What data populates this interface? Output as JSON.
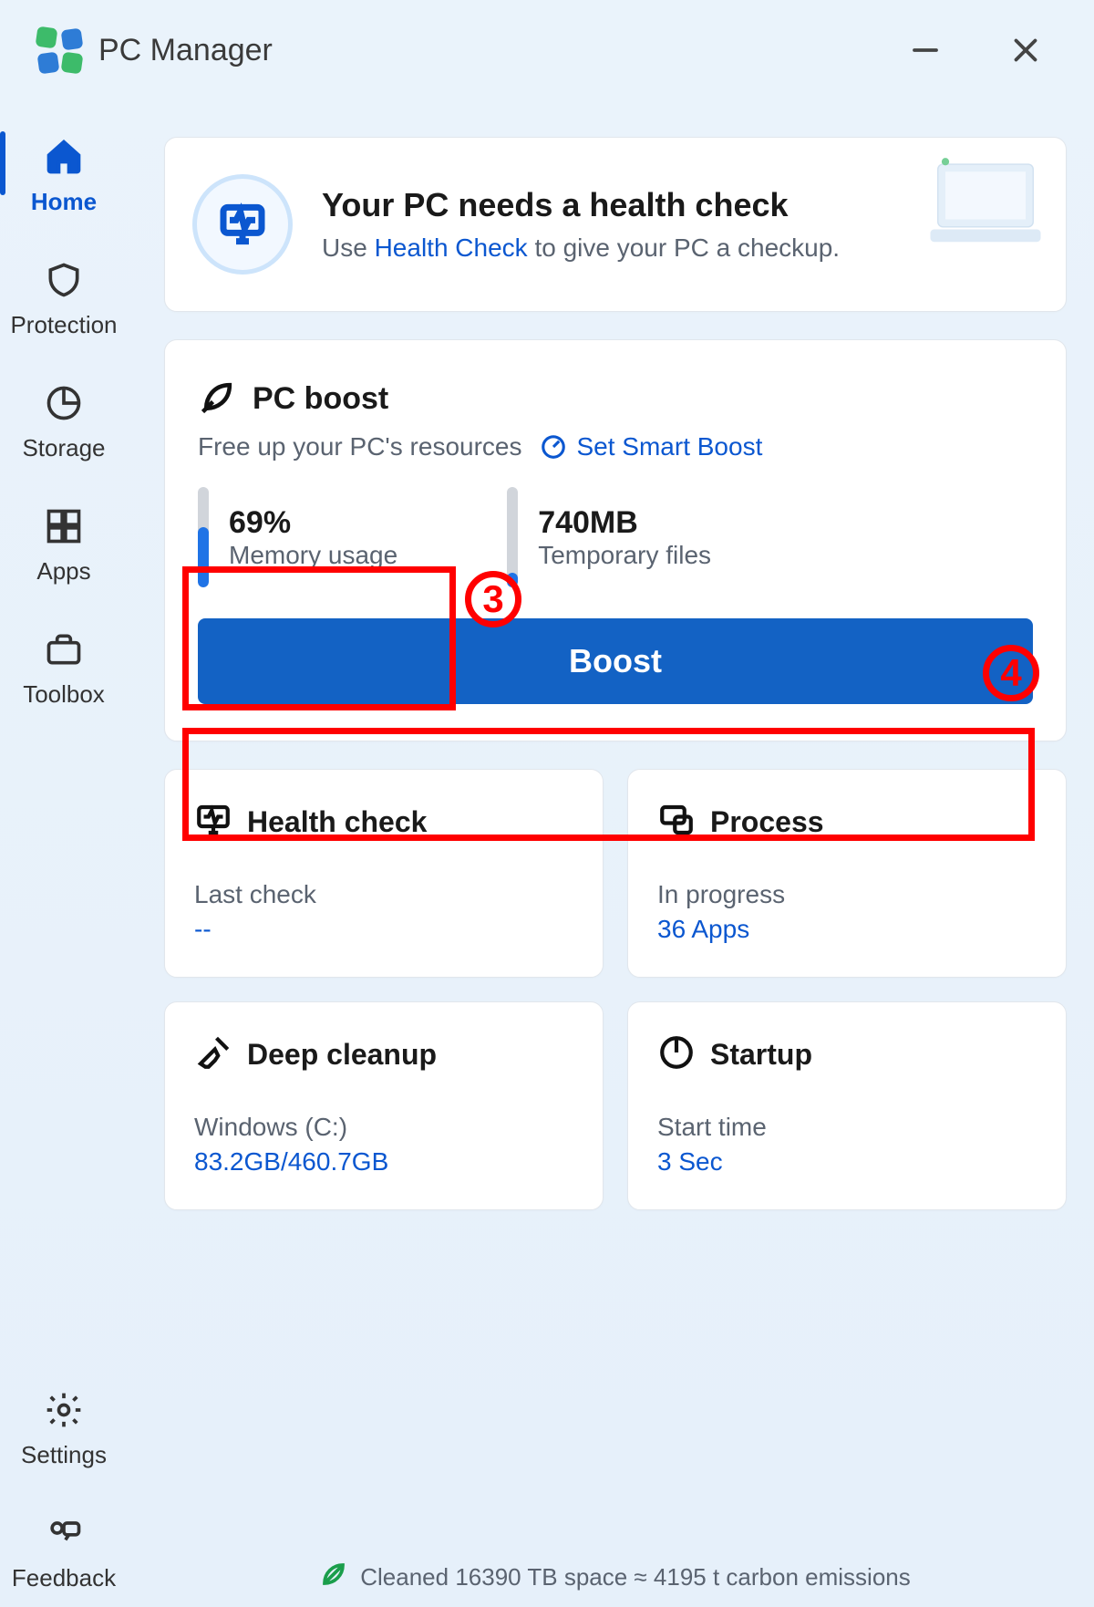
{
  "window": {
    "title": "PC Manager"
  },
  "sidebar": {
    "items": [
      {
        "id": "home",
        "label": "Home"
      },
      {
        "id": "protection",
        "label": "Protection"
      },
      {
        "id": "storage",
        "label": "Storage"
      },
      {
        "id": "apps",
        "label": "Apps"
      },
      {
        "id": "toolbox",
        "label": "Toolbox"
      }
    ],
    "bottom": [
      {
        "id": "settings",
        "label": "Settings"
      },
      {
        "id": "feedback",
        "label": "Feedback"
      }
    ],
    "active": "home"
  },
  "health_banner": {
    "title": "Your PC needs a health check",
    "subtitle_prefix": "Use ",
    "subtitle_link": "Health Check",
    "subtitle_suffix": " to give your PC a checkup."
  },
  "pc_boost": {
    "title": "PC boost",
    "subtitle": "Free up your PC's resources",
    "smart_boost_label": "Set Smart Boost",
    "memory": {
      "value": "69%",
      "label": "Memory usage",
      "fill_percent": 60
    },
    "temp": {
      "value": "740MB",
      "label": "Temporary files",
      "fill_percent": 15
    },
    "boost_label": "Boost"
  },
  "tiles": {
    "health_check": {
      "title": "Health check",
      "sub1": "Last check",
      "sub2": "--"
    },
    "process": {
      "title": "Process",
      "sub1": "In progress",
      "sub2": "36 Apps"
    },
    "deep_cleanup": {
      "title": "Deep cleanup",
      "sub1": "Windows (C:)",
      "sub2": "83.2GB/460.7GB"
    },
    "startup": {
      "title": "Startup",
      "sub1": "Start time",
      "sub2": "3 Sec"
    }
  },
  "footer": {
    "text": "Cleaned 16390 TB space ≈ 4195 t carbon emissions"
  },
  "annotations": {
    "marker3": "3",
    "marker4": "4"
  },
  "colors": {
    "accent": "#0b57d0",
    "boost_button": "#1362c4",
    "annotation": "#ff0000"
  }
}
